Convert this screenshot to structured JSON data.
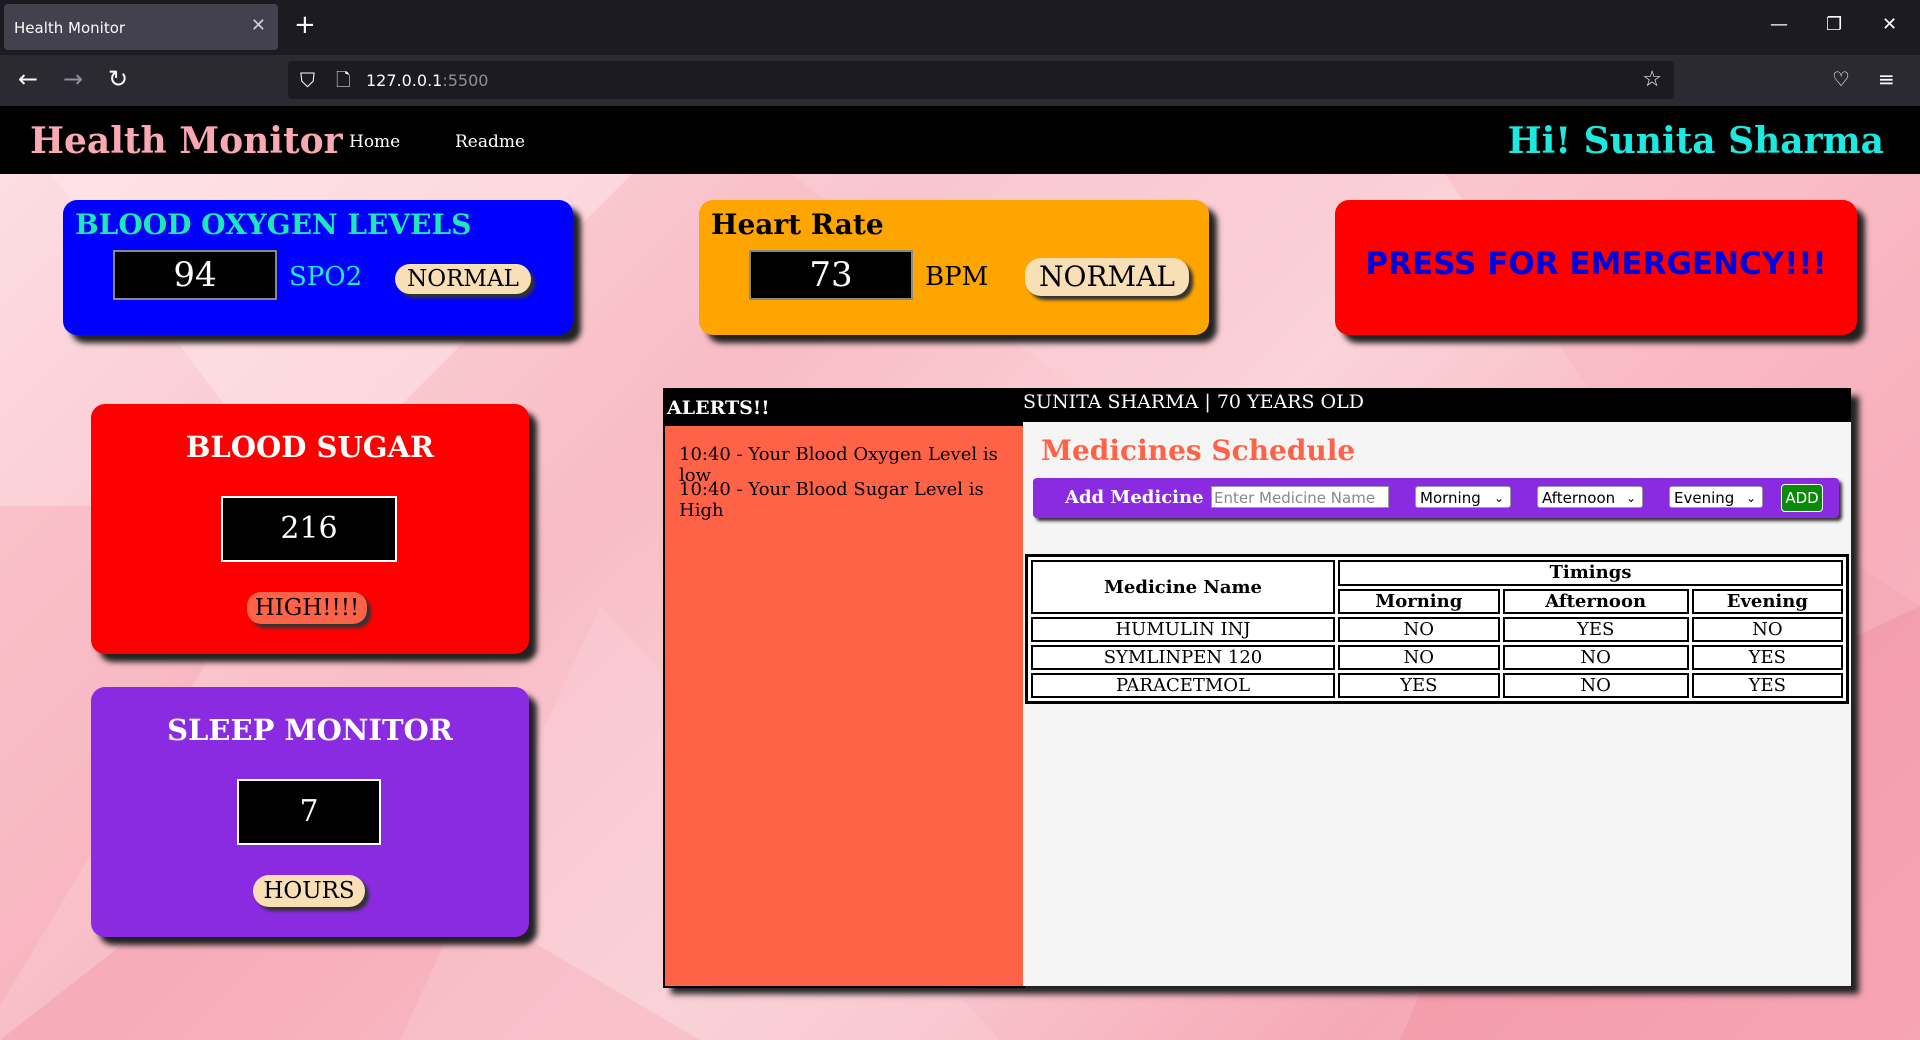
{
  "browser": {
    "tab_title": "Health Monitor",
    "tab_close": "✕",
    "new_tab": "+",
    "url_host": "127.0.0.1",
    "url_port": ":5500",
    "win_min": "—",
    "win_restore": "❐",
    "win_close": "✕"
  },
  "header": {
    "brand": "Health Monitor",
    "nav": [
      "Home",
      "Readme"
    ],
    "greeting": "Hi! Sunita Sharma"
  },
  "spo2": {
    "title": "BLOOD OXYGEN LEVELS",
    "value": "94",
    "unit": "SPO2",
    "status": "NORMAL"
  },
  "heart": {
    "title": "Heart Rate",
    "value": "73",
    "unit": "BPM",
    "status": "NORMAL"
  },
  "emergency": {
    "label": "PRESS FOR EMERGENCY!!!"
  },
  "sugar": {
    "title": "BLOOD SUGAR",
    "value": "216",
    "status": "HIGH!!!!"
  },
  "sleep": {
    "title": "SLEEP MONITOR",
    "value": "7",
    "unit": "HOURS"
  },
  "alerts": {
    "title": "ALERTS!!",
    "items": [
      "10:40 - Your Blood Oxygen Level is low",
      "10:40 - Your Blood Sugar Level is High"
    ]
  },
  "medicines": {
    "patient": "SUNITA SHARMA | 70 YEARS OLD",
    "title": "Medicines Schedule",
    "add_label": "Add Medicine",
    "input_placeholder": "Enter Medicine Name",
    "morning_select": "Morning",
    "afternoon_select": "Afternoon",
    "evening_select": "Evening",
    "add_button": "ADD",
    "col_name": "Medicine Name",
    "col_timings": "Timings",
    "col_morning": "Morning",
    "col_afternoon": "Afternoon",
    "col_evening": "Evening",
    "rows": [
      {
        "name": "HUMULIN INJ",
        "morning": "NO",
        "afternoon": "YES",
        "evening": "NO"
      },
      {
        "name": "SYMLINPEN 120",
        "morning": "NO",
        "afternoon": "NO",
        "evening": "YES"
      },
      {
        "name": "PARACETMOL",
        "morning": "YES",
        "afternoon": "NO",
        "evening": "YES"
      }
    ]
  }
}
